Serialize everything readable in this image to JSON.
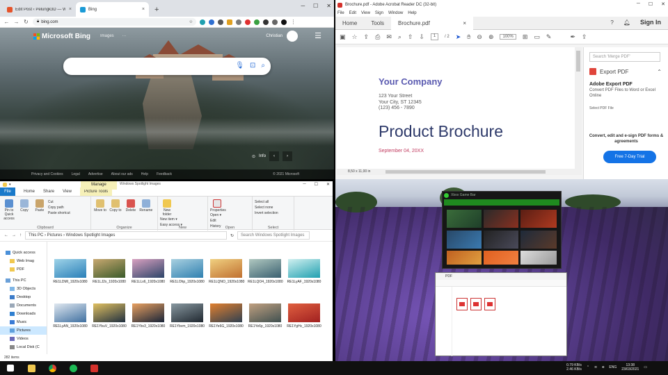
{
  "chrome": {
    "tabs": [
      {
        "title": "Edit Post ‹ Pelungk3D — WordPress"
      },
      {
        "title": "Bing"
      }
    ],
    "new_tab": "+",
    "url": "bing.com",
    "bing": {
      "logo": "Microsoft Bing",
      "nav": [
        "Images",
        "···"
      ],
      "user": "Christian",
      "info": "Info",
      "footer": [
        "Privacy and Cookies",
        "Legal",
        "Advertise",
        "About our ads",
        "Help",
        "Feedback"
      ],
      "copyright": "© 2021 Microsoft"
    }
  },
  "acrobat": {
    "title": "Brochure.pdf - Adobe Acrobat Reader DC (32-bit)",
    "menu": [
      "File",
      "Edit",
      "View",
      "Sign",
      "Window",
      "Help"
    ],
    "tabs": [
      "Home",
      "Tools",
      "Brochure.pdf"
    ],
    "sign_in": "Sign In",
    "page_current": "1",
    "page_total": "/ 2",
    "zoom": "100%",
    "doc": {
      "company": "Your Company",
      "street": "123 Your Street",
      "city": "Your City, ST 12345",
      "phone": "(123) 456 - 7890",
      "title": "Product Brochure",
      "date": "September 04, 20XX"
    },
    "dimensions": "8,50 x 11,00 in",
    "pane": {
      "search_placeholder": "Search 'Merge PDF'",
      "export_label": "Export PDF",
      "box_title": "Adobe Export PDF",
      "box_text": "Convert PDF Files to Word or Excel Online",
      "select_label": "Select PDF File",
      "convert": "Convert, edit and e-sign PDF forms & agreements",
      "trial": "Free 7-Day Trial"
    }
  },
  "explorer": {
    "context_tab": "Manage",
    "path_title": "Windows Spotlight Images",
    "tabs": [
      "File",
      "Home",
      "Share",
      "View",
      "Picture Tools"
    ],
    "ribbon": {
      "clipboard": {
        "label": "Clipboard",
        "pin": "Pin to Quick access",
        "copy": "Copy",
        "paste": "Paste",
        "cut": "Cut",
        "copy_path": "Copy path",
        "paste_shortcut": "Paste shortcut"
      },
      "organize": {
        "label": "Organize",
        "move": "Move to",
        "copy": "Copy to",
        "delete": "Delete",
        "rename": "Rename"
      },
      "new": {
        "label": "New",
        "folder": "New folder",
        "item": "New item ▾",
        "easy": "Easy access ▾"
      },
      "open": {
        "label": "Open",
        "properties": "Properties",
        "open": "Open ▾",
        "edit": "Edit",
        "history": "History"
      },
      "select": {
        "label": "Select",
        "all": "Select all",
        "none": "Select none",
        "invert": "Invert selection"
      }
    },
    "breadcrumb": "This PC  ›  Pictures  ›  Windows Spotlight Images",
    "search_placeholder": "Search Windows Spotlight Images",
    "nav": [
      "Quick access",
      "Web Imag",
      "PDF",
      "This PC",
      "3D Objects",
      "Desktop",
      "Documents",
      "Downloads",
      "Music",
      "Pictures",
      "Videos",
      "Local Disk (C"
    ],
    "files": [
      "RE1LDMI_1920x1080",
      "RE1LJ2x_1920x1080",
      "RE1LLx6_1920x1080",
      "RE1LOhp_1920x1080",
      "RE1LQNO_1920x1080",
      "RE1LQO4_1920x1080",
      "RE1LyAF_1920x1080",
      "RE1LyAN_1920x1080",
      "RE1YbuV_1920x1080",
      "RE1Ybv3_1920x1080",
      "RE1Ybvm_1920x1080",
      "RE1Ye6G_1920x1080",
      "RE1Ye6p_1920x1080",
      "RE1YgHc_1920x1080"
    ],
    "status": "282 items"
  },
  "desktop": {
    "xbox_title": "Xbox Game Bar",
    "pdf_window_title": "PDF"
  },
  "taskbar": {
    "net_up": "0.79 KB/s",
    "net_down": "2.46 KB/s",
    "lang": "ENG",
    "time": "13:38",
    "date": "23/03/2021"
  }
}
